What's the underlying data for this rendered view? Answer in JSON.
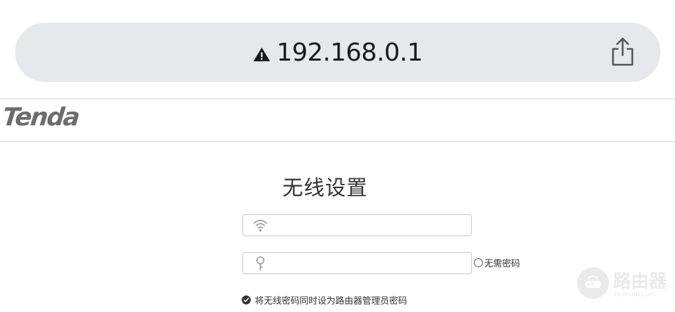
{
  "browser": {
    "url": "192.168.0.1",
    "security_icon": "warning-triangle-icon",
    "share_icon": "share-icon"
  },
  "brand": {
    "logo_text": "Tenda"
  },
  "main": {
    "title": "无线设置",
    "ssid_field": {
      "icon": "wifi-icon",
      "value": "",
      "placeholder": ""
    },
    "password_field": {
      "icon": "key-icon",
      "value": "",
      "placeholder": ""
    },
    "no_password_label": "无需密码",
    "no_password_checked": false,
    "sync_label": "将无线密码同时设为路由器管理员密码",
    "sync_checked": true
  },
  "watermark": {
    "name": "路由器",
    "url": "luyouqi.com"
  },
  "colors": {
    "address_bar_bg": "#e6e8eb",
    "logo": "#6d6d6d",
    "title": "#333333",
    "field_border": "#c8c8c8"
  }
}
